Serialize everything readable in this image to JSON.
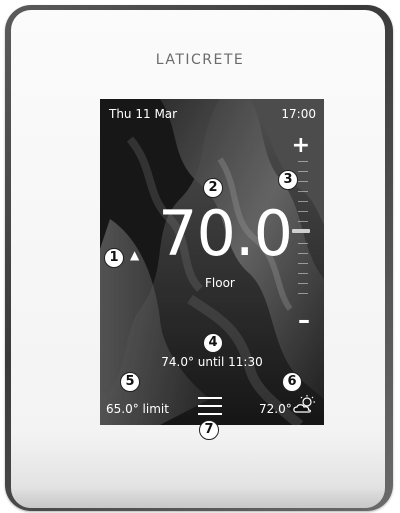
{
  "brand": "LATICRETE",
  "status_bar": {
    "date": "Thu 11 Mar",
    "time": "17:00"
  },
  "controls": {
    "increase_label": "+",
    "decrease_label": "–"
  },
  "thermostat": {
    "mode_arrow": "▲",
    "setpoint": "70.0",
    "setpoint_label": "Floor",
    "schedule": "74.0° until 11:30",
    "floor_limit": "65.0° limit",
    "outdoor_temp": "72.0°",
    "weather_icon": "partly-cloudy-icon",
    "menu_icon": "hamburger-menu-icon",
    "setpoint_slider_level": 0.5
  },
  "callouts": [
    "1",
    "2",
    "3",
    "4",
    "5",
    "6",
    "7"
  ],
  "colors": {
    "screen_text": "#ffffff",
    "brand_text": "#6b6b6b",
    "callout_border": "#222222"
  }
}
